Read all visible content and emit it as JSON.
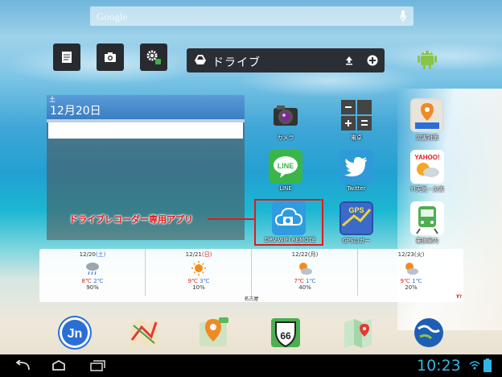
{
  "search": {
    "label": "Google"
  },
  "drive": {
    "label": "ドライブ"
  },
  "calendar": {
    "day_of_week": "土",
    "date": "12月20日"
  },
  "apps": [
    {
      "name": "カメラ",
      "icon": "camera-icon"
    },
    {
      "name": "電卓",
      "icon": "calculator-icon"
    },
    {
      "name": "災害対策",
      "icon": "disaster-map-icon"
    },
    {
      "name": "LINE",
      "icon": "line-icon"
    },
    {
      "name": "Twitter",
      "icon": "twitter-bird-icon"
    },
    {
      "name": "Y!天気・災害",
      "icon": "yahoo-weather-icon"
    },
    {
      "name": "DRV-WIFI REMOTE",
      "icon": "cloud-camera-icon"
    },
    {
      "name": "GPSロガー",
      "icon": "gps-logger-icon"
    },
    {
      "name": "乗換案内",
      "icon": "train-icon"
    }
  ],
  "callout": {
    "text": "ドライブレコーダー専用アプリ"
  },
  "weather": {
    "location": "名古屋",
    "brand": "Y!",
    "days": [
      {
        "date": "12/20",
        "wd": "(土)",
        "high": "8℃",
        "low": "2℃",
        "precip": "90%",
        "wd_color": "#2a6fd6",
        "icon": "cloudy-rain-icon"
      },
      {
        "date": "12/21",
        "wd": "(日)",
        "high": "9℃",
        "low": "3℃",
        "precip": "10%",
        "wd_color": "#e01a1a",
        "icon": "sun-icon"
      },
      {
        "date": "12/22",
        "wd": "(月)",
        "high": "7℃",
        "low": "1℃",
        "precip": "40%",
        "wd_color": "#333333",
        "icon": "sun-cloud-icon"
      },
      {
        "date": "12/23",
        "wd": "(火)",
        "high": "9℃",
        "low": "1℃",
        "precip": "20%",
        "wd_color": "#333333",
        "icon": "sun-cloud-icon"
      }
    ]
  },
  "status": {
    "time": "10:23"
  },
  "colors": {
    "accent": "#33b5e5",
    "highlight": "#e01a1a"
  }
}
